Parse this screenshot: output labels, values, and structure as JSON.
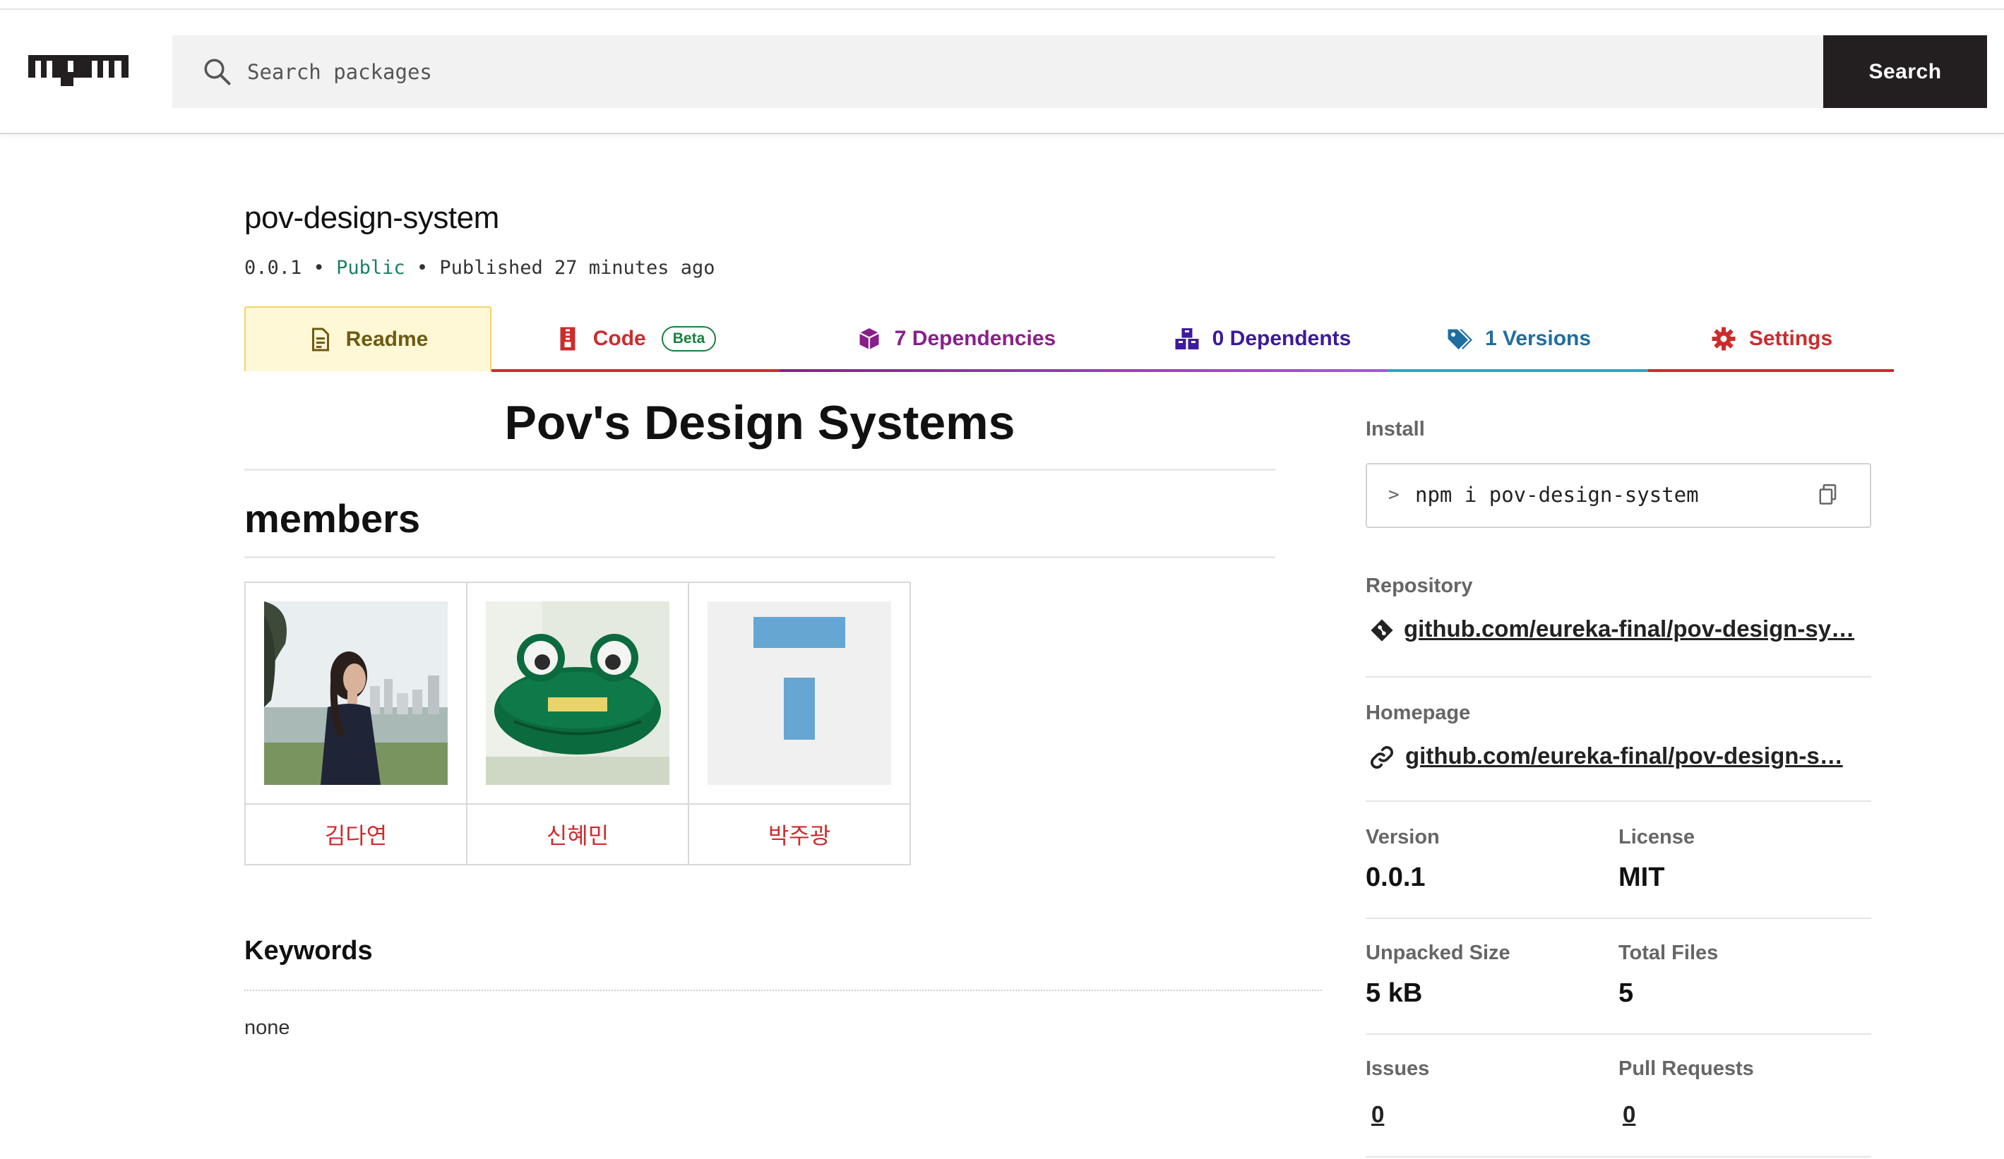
{
  "header": {
    "logo_text": "npm",
    "search_placeholder": "Search packages",
    "search_button": "Search"
  },
  "package": {
    "name": "pov-design-system",
    "version": "0.0.1",
    "visibility": "Public",
    "published": "Published 27 minutes ago",
    "separator": "•"
  },
  "tabs": [
    {
      "label": "Readme",
      "color": "#6e5a12",
      "icon": "document-icon"
    },
    {
      "label": "Code",
      "badge": "Beta",
      "color": "#cb2d2d",
      "icon": "file-zip-icon"
    },
    {
      "label": "7 Dependencies",
      "color": "#8a1f8a",
      "icon": "box-icon"
    },
    {
      "label": "0 Dependents",
      "color": "#3d1a9e",
      "icon": "boxes-icon"
    },
    {
      "label": "1 Versions",
      "color": "#1f6ea0",
      "icon": "tags-icon"
    },
    {
      "label": "Settings",
      "color": "#cb2d2d",
      "icon": "gear-icon"
    }
  ],
  "readme": {
    "title": "Pov's Design Systems",
    "members_heading": "members",
    "members": [
      {
        "name": "김다연",
        "photo": "portrait-photo"
      },
      {
        "name": "신혜민",
        "photo": "frog-photo"
      },
      {
        "name": "박주광",
        "photo": "placeholder-image"
      }
    ]
  },
  "keywords": {
    "heading": "Keywords",
    "value": "none"
  },
  "sidebar": {
    "install_label": "Install",
    "install_caret": ">",
    "install_command": "npm i pov-design-system",
    "repository_label": "Repository",
    "repository_link": "github.com/eureka-final/pov-design-sy…",
    "homepage_label": "Homepage",
    "homepage_link": "github.com/eureka-final/pov-design-s…",
    "version_label": "Version",
    "version_value": "0.0.1",
    "license_label": "License",
    "license_value": "MIT",
    "unpacked_label": "Unpacked Size",
    "unpacked_value": "5 kB",
    "files_label": "Total Files",
    "files_value": "5",
    "issues_label": "Issues",
    "issues_value": "0",
    "prs_label": "Pull Requests",
    "prs_value": "0"
  },
  "colors": {
    "accent_red": "#cb2d2d",
    "public_green": "#1a7f64",
    "search_button_bg": "#231f20"
  }
}
